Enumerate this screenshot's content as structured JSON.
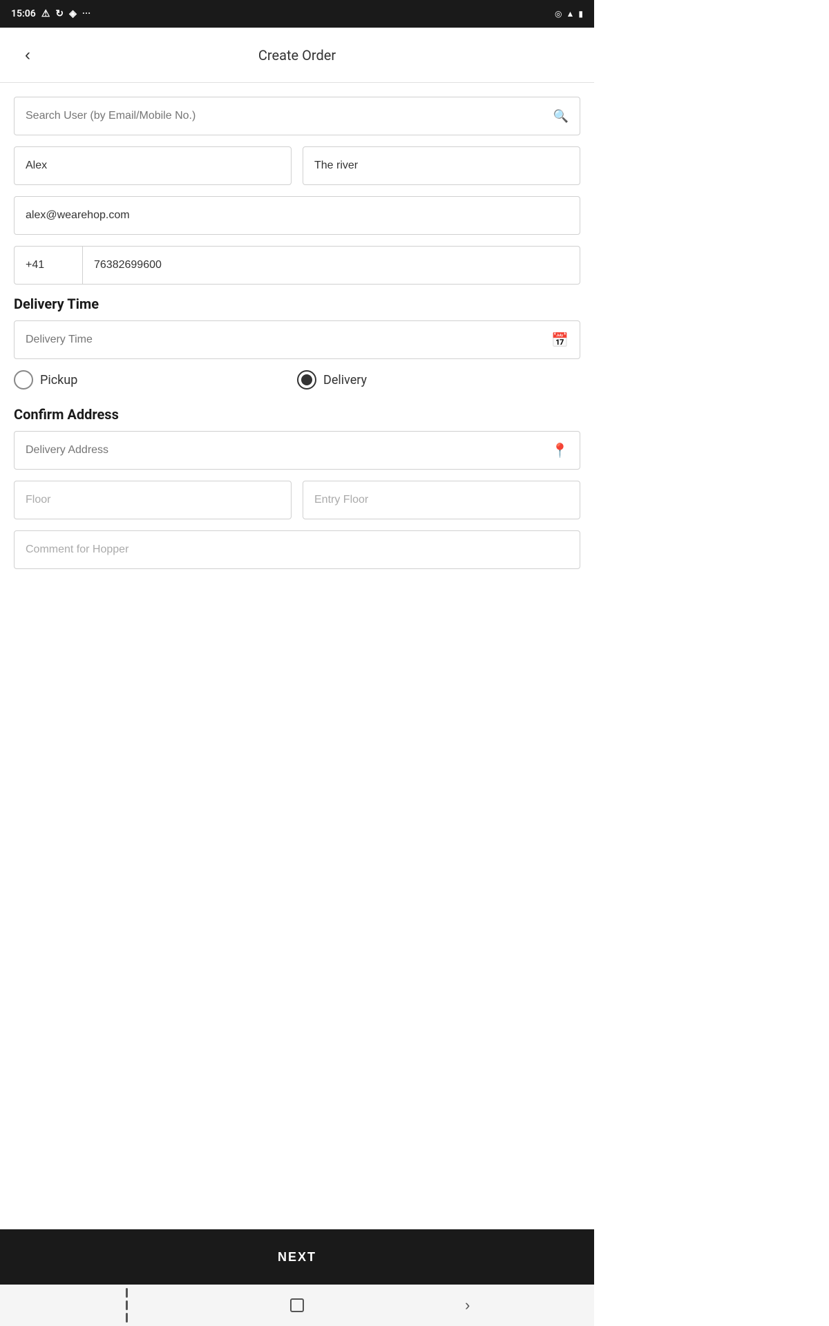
{
  "statusBar": {
    "time": "15:06",
    "icons": [
      "alert",
      "rotate",
      "signal",
      "wifi",
      "battery"
    ]
  },
  "header": {
    "title": "Create Order",
    "backLabel": "‹"
  },
  "search": {
    "placeholder": "Search User (by Email/Mobile No.)"
  },
  "form": {
    "firstName": "Alex",
    "lastName": "The river",
    "email": "alex@wearehop.com",
    "countryCode": "+41",
    "phone": "76382699600",
    "deliveryTimeLabel": "Delivery Time",
    "deliveryTimePlaceholder": "Delivery Time",
    "pickupLabel": "Pickup",
    "deliveryLabel": "Delivery",
    "confirmAddressLabel": "Confirm Address",
    "deliveryAddressPlaceholder": "Delivery Address",
    "floorPlaceholder": "Floor",
    "entryFloorPlaceholder": "Entry Floor",
    "commentPlaceholder": "Comment for Hopper"
  },
  "footer": {
    "nextLabel": "NEXT"
  },
  "androidNav": {
    "backLabel": "‹"
  }
}
